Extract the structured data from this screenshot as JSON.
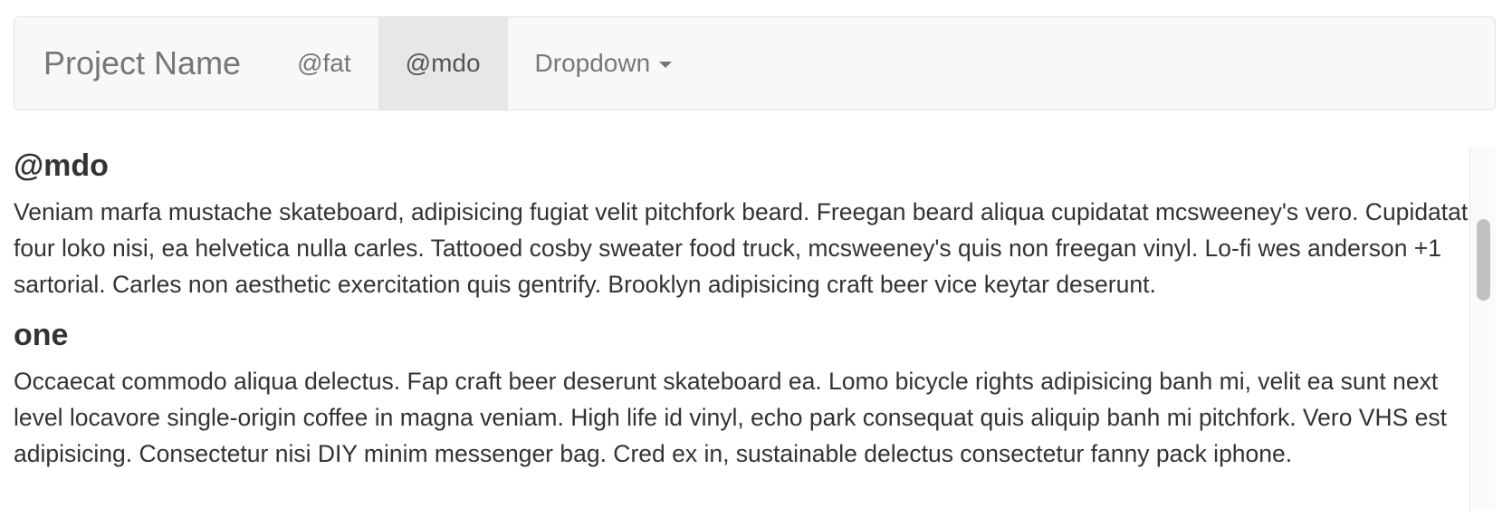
{
  "navbar": {
    "brand": "Project Name",
    "items": [
      {
        "label": "@fat",
        "active": false
      },
      {
        "label": "@mdo",
        "active": true
      },
      {
        "label": "Dropdown",
        "active": false
      }
    ]
  },
  "content": {
    "sections": [
      {
        "heading": "@mdo",
        "text": "Veniam marfa mustache skateboard, adipisicing fugiat velit pitchfork beard. Freegan beard aliqua cupidatat mcsweeney's vero. Cupidatat four loko nisi, ea helvetica nulla carles. Tattooed cosby sweater food truck, mcsweeney's quis non freegan vinyl. Lo-fi wes anderson +1 sartorial. Carles non aesthetic exercitation quis gentrify. Brooklyn adipisicing craft beer vice keytar deserunt."
      },
      {
        "heading": "one",
        "text": "Occaecat commodo aliqua delectus. Fap craft beer deserunt skateboard ea. Lomo bicycle rights adipisicing banh mi, velit ea sunt next level locavore single-origin coffee in magna veniam. High life id vinyl, echo park consequat quis aliquip banh mi pitchfork. Vero VHS est adipisicing. Consectetur nisi DIY minim messenger bag. Cred ex in, sustainable delectus consectetur fanny pack iphone."
      }
    ]
  },
  "colors": {
    "navbar_bg": "#f8f8f8",
    "active_bg": "#e7e7e7",
    "nav_text": "#777777",
    "body_text": "#333333"
  },
  "icons": {
    "dropdown": "caret-down-icon"
  }
}
